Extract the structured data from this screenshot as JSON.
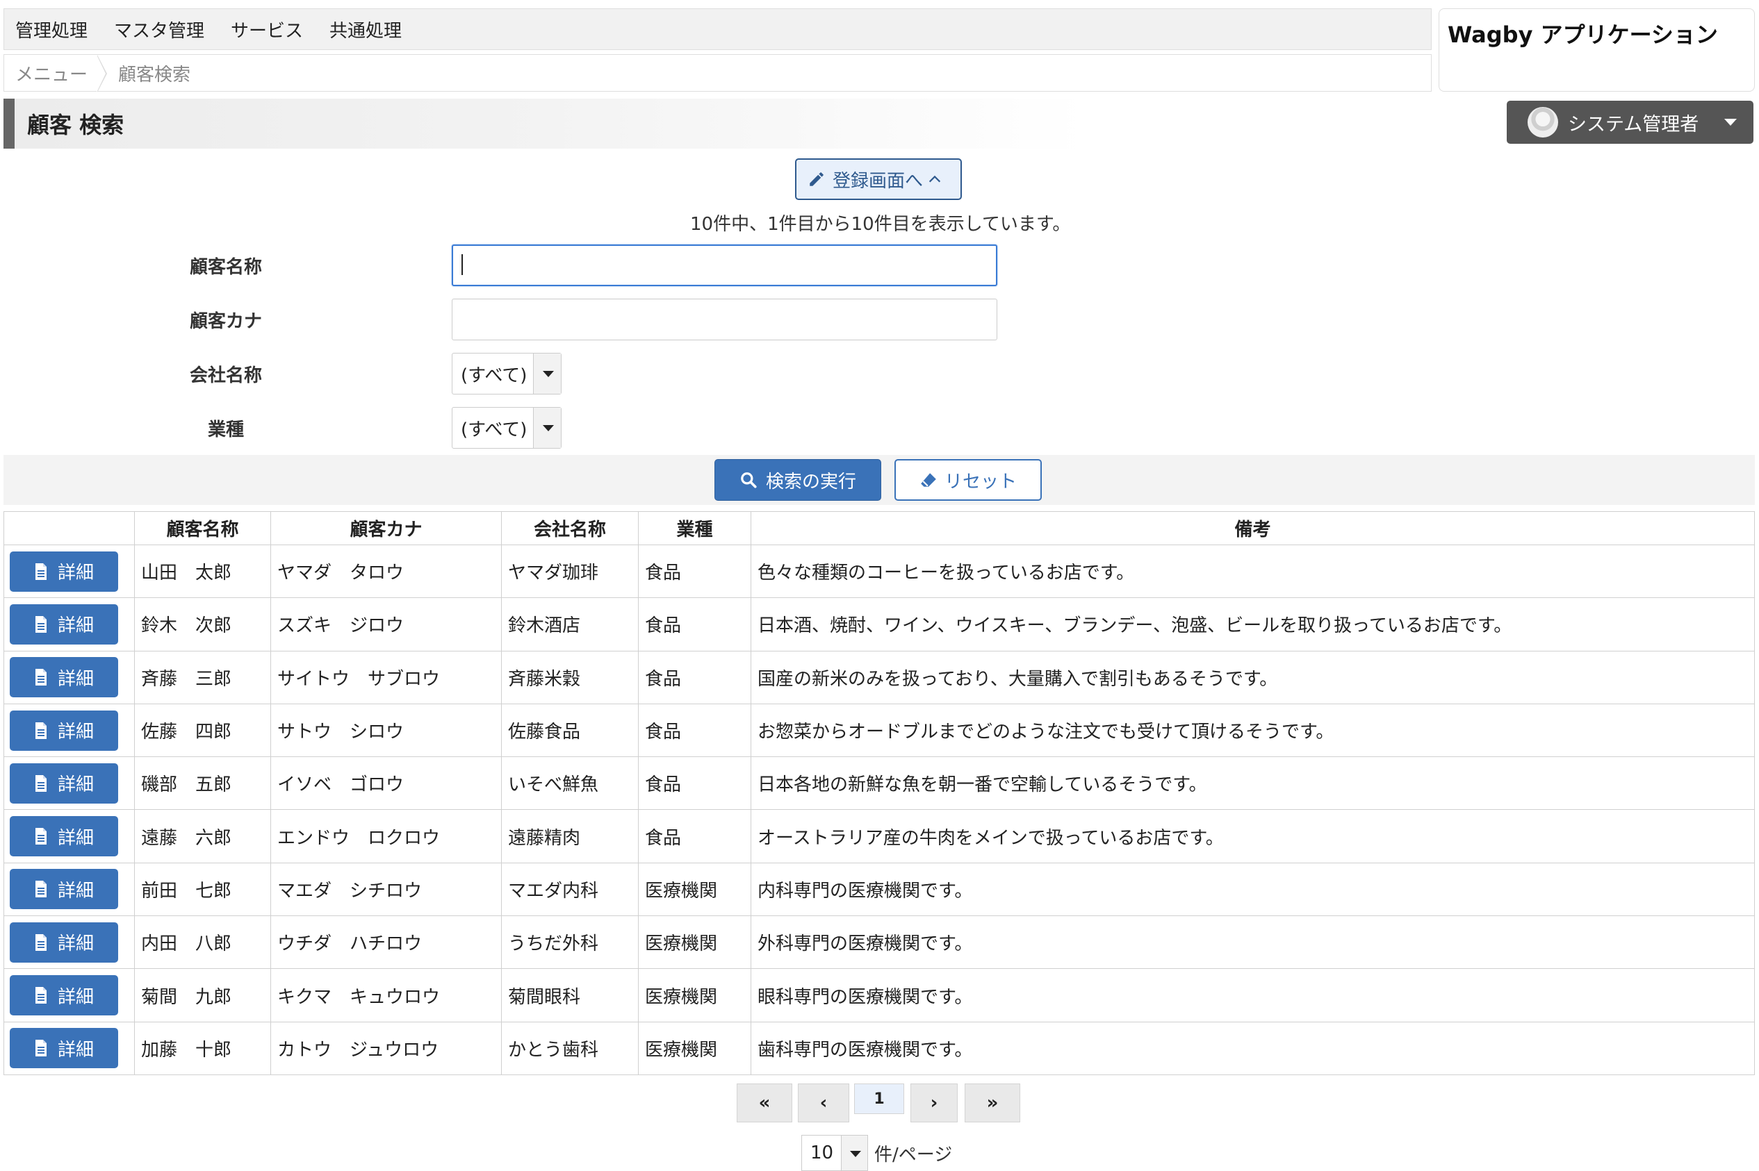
{
  "nav": {
    "items": [
      "管理処理",
      "マスタ管理",
      "サービス",
      "共通処理"
    ]
  },
  "breadcrumb": {
    "menu": "メニュー",
    "current": "顧客検索"
  },
  "app": {
    "title": "Wagby アプリケーション"
  },
  "user": {
    "name": "システム管理者"
  },
  "page": {
    "title": "顧客 検索"
  },
  "register_button": "登録画面へ",
  "result_info": "10件中、1件目から10件目を表示しています。",
  "search": {
    "fields": {
      "name": {
        "label": "顧客名称",
        "value": ""
      },
      "kana": {
        "label": "顧客カナ",
        "value": ""
      },
      "company": {
        "label": "会社名称",
        "selected": "(すべて)"
      },
      "industry": {
        "label": "業種",
        "selected": "(すべて)"
      }
    },
    "submit_label": "検索の実行",
    "reset_label": "リセット"
  },
  "table": {
    "headers": [
      "",
      "顧客名称",
      "顧客カナ",
      "会社名称",
      "業種",
      "備考"
    ],
    "detail_label": "詳細",
    "rows": [
      {
        "name": "山田　太郎",
        "kana": "ヤマダ　タロウ",
        "company": "ヤマダ珈琲",
        "industry": "食品",
        "note": "色々な種類のコーヒーを扱っているお店です。"
      },
      {
        "name": "鈴木　次郎",
        "kana": "スズキ　ジロウ",
        "company": "鈴木酒店",
        "industry": "食品",
        "note": "日本酒、焼酎、ワイン、ウイスキー、ブランデー、泡盛、ビールを取り扱っているお店です。"
      },
      {
        "name": "斉藤　三郎",
        "kana": "サイトウ　サブロウ",
        "company": "斉藤米穀",
        "industry": "食品",
        "note": "国産の新米のみを扱っており、大量購入で割引もあるそうです。"
      },
      {
        "name": "佐藤　四郎",
        "kana": "サトウ　シロウ",
        "company": "佐藤食品",
        "industry": "食品",
        "note": "お惣菜からオードブルまでどのような注文でも受けて頂けるそうです。"
      },
      {
        "name": "磯部　五郎",
        "kana": "イソベ　ゴロウ",
        "company": "いそべ鮮魚",
        "industry": "食品",
        "note": "日本各地の新鮮な魚を朝一番で空輸しているそうです。"
      },
      {
        "name": "遠藤　六郎",
        "kana": "エンドウ　ロクロウ",
        "company": "遠藤精肉",
        "industry": "食品",
        "note": "オーストラリア産の牛肉をメインで扱っているお店です。"
      },
      {
        "name": "前田　七郎",
        "kana": "マエダ　シチロウ",
        "company": "マエダ内科",
        "industry": "医療機関",
        "note": "内科専門の医療機関です。"
      },
      {
        "name": "内田　八郎",
        "kana": "ウチダ　ハチロウ",
        "company": "うちだ外科",
        "industry": "医療機関",
        "note": "外科専門の医療機関です。"
      },
      {
        "name": "菊間　九郎",
        "kana": "キクマ　キュウロウ",
        "company": "菊間眼科",
        "industry": "医療機関",
        "note": "眼科専門の医療機関です。"
      },
      {
        "name": "加藤　十郎",
        "kana": "カトウ　ジュウロウ",
        "company": "かとう歯科",
        "industry": "医療機関",
        "note": "歯科専門の医療機関です。"
      }
    ]
  },
  "pagination": {
    "first": "«",
    "prev": "‹",
    "current": "1",
    "next": "›",
    "last": "»",
    "per_page": "10",
    "per_page_label": "件/ページ"
  },
  "colors": {
    "primary": "#3a72b8",
    "primary_dark": "#2f5a8e",
    "user_button": "#555555"
  }
}
